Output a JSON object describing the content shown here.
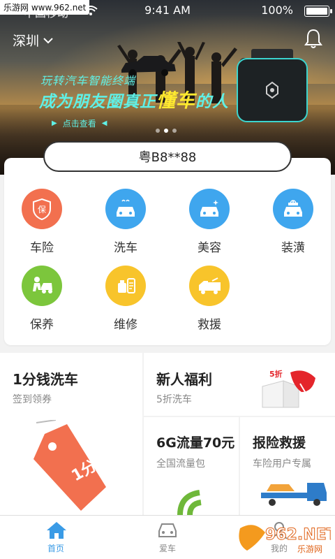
{
  "watermark_top": "乐游网 www.962.net",
  "status_bar": {
    "carrier": "中国移动",
    "time": "9:41 AM",
    "battery": "100%"
  },
  "header": {
    "city": "深圳"
  },
  "banner": {
    "line1": "玩转汽车智能终端",
    "line2_prefix": "成为朋友圈真正",
    "line2_emphasis": "懂车",
    "line2_suffix": "的人",
    "cta": "点击查看",
    "slide_count": 3,
    "active_slide": 2
  },
  "plate": {
    "value": "粤B8**88"
  },
  "services": [
    {
      "label": "车险",
      "icon": "insurance-shield-icon",
      "color": "#f2704f"
    },
    {
      "label": "洗车",
      "icon": "car-wash-icon",
      "color": "#3fa6ee"
    },
    {
      "label": "美容",
      "icon": "car-beauty-icon",
      "color": "#3fa6ee"
    },
    {
      "label": "装潢",
      "icon": "car-decoration-icon",
      "color": "#3fa6ee"
    },
    {
      "label": "保养",
      "icon": "maintenance-icon",
      "color": "#7cc63c"
    },
    {
      "label": "维修",
      "icon": "repair-icon",
      "color": "#f8c42b"
    },
    {
      "label": "救援",
      "icon": "tow-truck-icon",
      "color": "#f8c42b"
    }
  ],
  "promos": {
    "wash": {
      "title": "1分钱洗车",
      "sub": "签到领券",
      "tag_text": "1分"
    },
    "newuser": {
      "title": "新人福利",
      "sub": "5折洗车",
      "badge": "5折"
    },
    "data": {
      "title": "6G流量70元",
      "sub": "全国流量包"
    },
    "rescue": {
      "title": "报险救援",
      "sub": "车险用户专属"
    }
  },
  "tabs": [
    {
      "label": "首页",
      "active": true
    },
    {
      "label": "爱车",
      "active": false
    },
    {
      "label": "我的",
      "active": false
    }
  ],
  "watermark_bottom": {
    "brand": "962.NET",
    "sub": "乐游网"
  },
  "colors": {
    "accent": "#3a9be6",
    "banner_text": "#5ff0e6",
    "banner_emphasis": "#ffea2f"
  }
}
